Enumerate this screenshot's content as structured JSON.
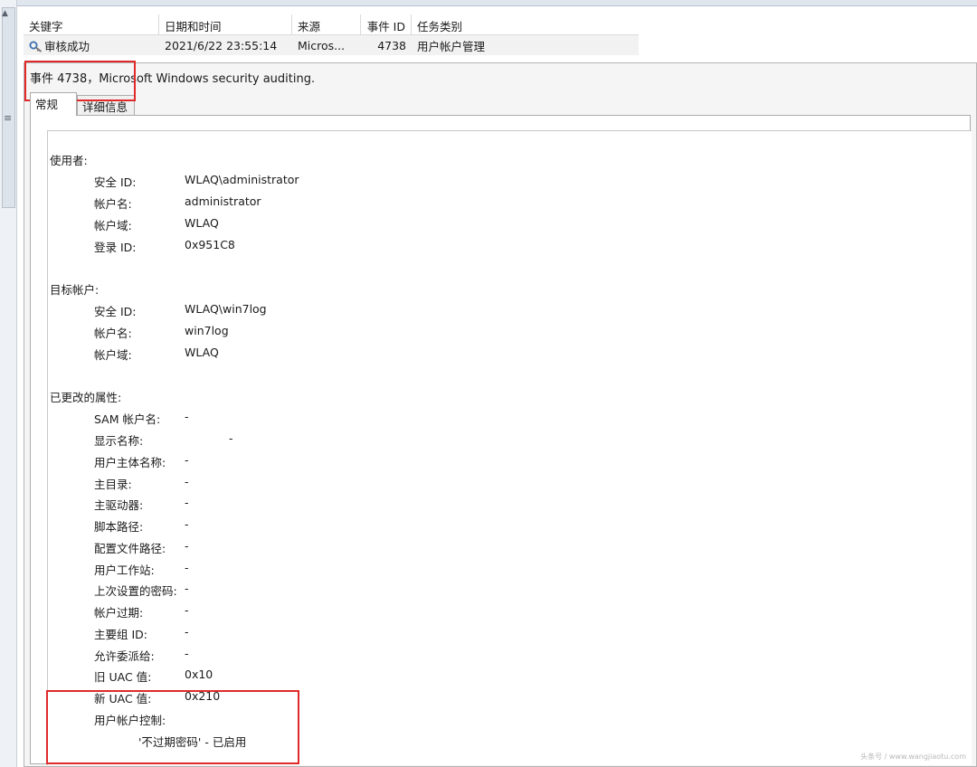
{
  "list": {
    "columns": [
      "关键字",
      "日期和时间",
      "来源",
      "事件 ID",
      "任务类别"
    ],
    "rows": [
      {
        "keyword": "审核成功",
        "datetime": "2021/6/22 23:55:14",
        "source": "Micros...",
        "event_id": "4738",
        "task": "用户帐户管理"
      }
    ]
  },
  "detail": {
    "title": "事件 4738，Microsoft Windows security auditing.",
    "tabs": [
      "常规",
      "详细信息"
    ],
    "subject_header": "使用者:",
    "subject": [
      {
        "label": "安全 ID:",
        "value": "WLAQ\\administrator"
      },
      {
        "label": "帐户名:",
        "value": "administrator"
      },
      {
        "label": "帐户域:",
        "value": "WLAQ"
      },
      {
        "label": "登录 ID:",
        "value": "0x951C8"
      }
    ],
    "target_header": "目标帐户:",
    "target": [
      {
        "label": "安全 ID:",
        "value": "WLAQ\\win7log"
      },
      {
        "label": "帐户名:",
        "value": "win7log"
      },
      {
        "label": "帐户域:",
        "value": "WLAQ"
      }
    ],
    "changed_header": "已更改的属性:",
    "changed": [
      {
        "label": "SAM 帐户名:",
        "value": "-"
      },
      {
        "label": "显示名称:",
        "value": "-"
      },
      {
        "label": "用户主体名称:",
        "value": "-"
      },
      {
        "label": "主目录:",
        "value": "-"
      },
      {
        "label": "主驱动器:",
        "value": "-"
      },
      {
        "label": "脚本路径:",
        "value": "-"
      },
      {
        "label": "配置文件路径:",
        "value": "-"
      },
      {
        "label": "用户工作站:",
        "value": "-"
      },
      {
        "label": "上次设置的密码:",
        "value": "-"
      },
      {
        "label": "帐户过期:",
        "value": "-"
      },
      {
        "label": "主要组 ID:",
        "value": "-"
      },
      {
        "label": "允许委派给:",
        "value": "-"
      },
      {
        "label": "旧 UAC 值:",
        "value": "0x10"
      },
      {
        "label": "新 UAC 值:",
        "value": "0x210"
      },
      {
        "label": "用户帐户控制:",
        "value": ""
      }
    ],
    "uac_flag": "'不过期密码' - 已启用"
  },
  "watermark": "头条号 / www.wangjiaotu.com",
  "colors": {
    "highlight_box": "#e02a2a",
    "row_selected": "#f2f2f2"
  },
  "icons": {
    "keyword": "audit-key-icon"
  }
}
